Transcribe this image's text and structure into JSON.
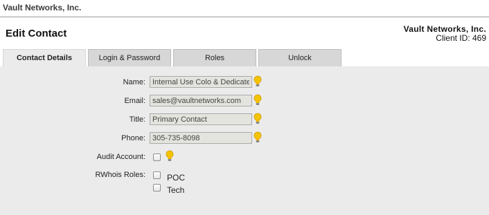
{
  "header": {
    "company": "Vault Networks, Inc."
  },
  "page": {
    "title": "Edit Contact",
    "client_name": "Vault Networks, Inc.",
    "client_id": "Client ID: 469"
  },
  "tabs": [
    {
      "label": "Contact Details",
      "active": true
    },
    {
      "label": "Login & Password",
      "active": false
    },
    {
      "label": "Roles",
      "active": false
    },
    {
      "label": "Unlock",
      "active": false
    }
  ],
  "form": {
    "name": {
      "label": "Name:",
      "value": "Internal Use Colo & Dedicated"
    },
    "email": {
      "label": "Email:",
      "value": "sales@vaultnetworks.com"
    },
    "title": {
      "label": "Title:",
      "value": "Primary Contact"
    },
    "phone": {
      "label": "Phone:",
      "value": "305-735-8098"
    },
    "audit": {
      "label": "Audit Account:",
      "checked": false
    },
    "rwhois": {
      "label": "RWhois Roles:",
      "options": [
        {
          "label": "POC",
          "checked": false
        },
        {
          "label": "Tech",
          "checked": false
        }
      ]
    }
  },
  "icons": {
    "help": "lightbulb-icon"
  },
  "colors": {
    "panel": "#ebebeb",
    "tab": "#d7d7d7",
    "bulb": "#f5c400"
  }
}
